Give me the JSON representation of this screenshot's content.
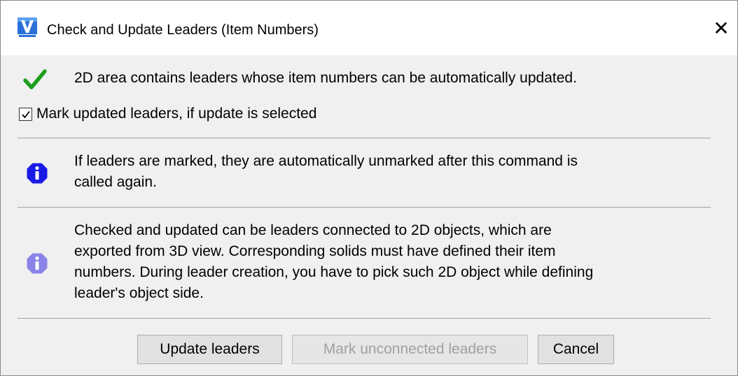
{
  "window": {
    "title": "Check and Update Leaders (Item Numbers)",
    "close_glyph": "✕",
    "app_icon": "vericad-logo-icon"
  },
  "status": {
    "icon": "checkmark-icon",
    "icon_color": "#1e9e1e",
    "text": "2D area contains leaders whose item numbers can be automatically updated."
  },
  "mark_option": {
    "checked": true,
    "label": "Mark updated leaders, if update is selected"
  },
  "info1": {
    "icon": "info-icon",
    "icon_color": "#1a1ae6",
    "line1": "If leaders are marked, they are automatically unmarked after this command is",
    "line2": "called again."
  },
  "info2": {
    "icon": "info-icon",
    "icon_color": "#8a84e8",
    "line1": "Checked and updated can be leaders connected to 2D objects, which are",
    "line2": "exported from 3D view. Corresponding solids must have defined their item",
    "line3": "numbers. During leader creation, you have to pick such 2D object while defining",
    "line4": "leader's object side."
  },
  "buttons": {
    "update_label": "Update leaders",
    "mark_unconnected_label": "Mark unconnected leaders",
    "mark_unconnected_enabled": false,
    "cancel_label": "Cancel"
  }
}
